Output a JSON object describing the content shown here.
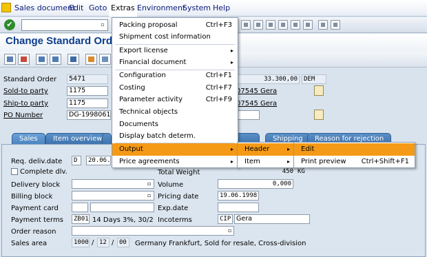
{
  "menubar": {
    "items": [
      "Sales document",
      "Edit",
      "Goto",
      "Extras",
      "Environment",
      "System",
      "Help"
    ]
  },
  "title": "Change Standard Order",
  "header": {
    "standard_order_label": "Standard Order",
    "standard_order_value": "5471",
    "net_value": "33.300,00",
    "currency": "DEM",
    "sold_to_label": "Sold-to party",
    "sold_to_value": "1175",
    "sold_to_name": "07545 Gera",
    "ship_to_label": "Ship-to party",
    "ship_to_value": "1175",
    "ship_to_name": "07545 Gera",
    "po_label": "PO Number",
    "po_value": "DG-19980619"
  },
  "tabs": [
    "Sales",
    "Item overview",
    "Item detail",
    "Ordering party",
    "Procurement",
    "Shipping",
    "Reason for rejection"
  ],
  "sales": {
    "req_deliv_label": "Req. deliv.date",
    "req_deliv_type": "D",
    "req_deliv_date": "20.06.",
    "complete_dlv_label": "Complete dlv.",
    "total_weight_label": "Total Weight",
    "total_weight_value": "450",
    "weight_unit": "KG",
    "delivery_block_label": "Delivery block",
    "volume_label": "Volume",
    "volume_value": "0,000",
    "billing_block_label": "Billing block",
    "pricing_date_label": "Pricing date",
    "pricing_date_value": "19.06.1998",
    "payment_card_label": "Payment card",
    "exp_date_label": "Exp.date",
    "payment_terms_label": "Payment terms",
    "payment_terms_code": "ZB01",
    "payment_terms_text": "14 Days 3%, 30/2",
    "incoterms_label": "Incoterms",
    "incoterms_code": "CIP",
    "incoterms_place": "Gera",
    "order_reason_label": "Order reason",
    "sales_area_label": "Sales area",
    "sales_org": "1000",
    "dist_channel": "12",
    "division": "00",
    "sales_area_text": "Germany Frankfurt, Sold for resale, Cross-division",
    "slash": "/"
  },
  "extras_menu": [
    {
      "label": "Packing proposal",
      "shortcut": "Ctrl+F3"
    },
    {
      "label": "Shipment cost information",
      "shortcut": ""
    },
    {
      "label": "Export license",
      "shortcut": ""
    },
    {
      "label": "Financial document",
      "shortcut": ""
    },
    {
      "label": "Configuration",
      "shortcut": "Ctrl+F1"
    },
    {
      "label": "Costing",
      "shortcut": "Ctrl+F7"
    },
    {
      "label": "Parameter activity",
      "shortcut": "Ctrl+F9"
    },
    {
      "label": "Technical objects",
      "shortcut": ""
    },
    {
      "label": "Documents",
      "shortcut": ""
    },
    {
      "label": "Display batch determ.",
      "shortcut": ""
    },
    {
      "label": "Output",
      "shortcut": ""
    },
    {
      "label": "Price agreements",
      "shortcut": ""
    }
  ],
  "output_menu": [
    {
      "label": "Header"
    },
    {
      "label": "Item"
    }
  ],
  "header_menu": [
    {
      "label": "Edit",
      "shortcut": ""
    },
    {
      "label": "Print preview",
      "shortcut": "Ctrl+Shift+F1"
    }
  ],
  "colors": {
    "menu_highlight": "#f59a16",
    "title_blue": "#0b3c8c",
    "tab_blue": "#4d86c2",
    "ok_green": "#2e8b2e"
  },
  "icons": {
    "submenu": "▸",
    "ok": "✔",
    "f4_help": "▫"
  }
}
